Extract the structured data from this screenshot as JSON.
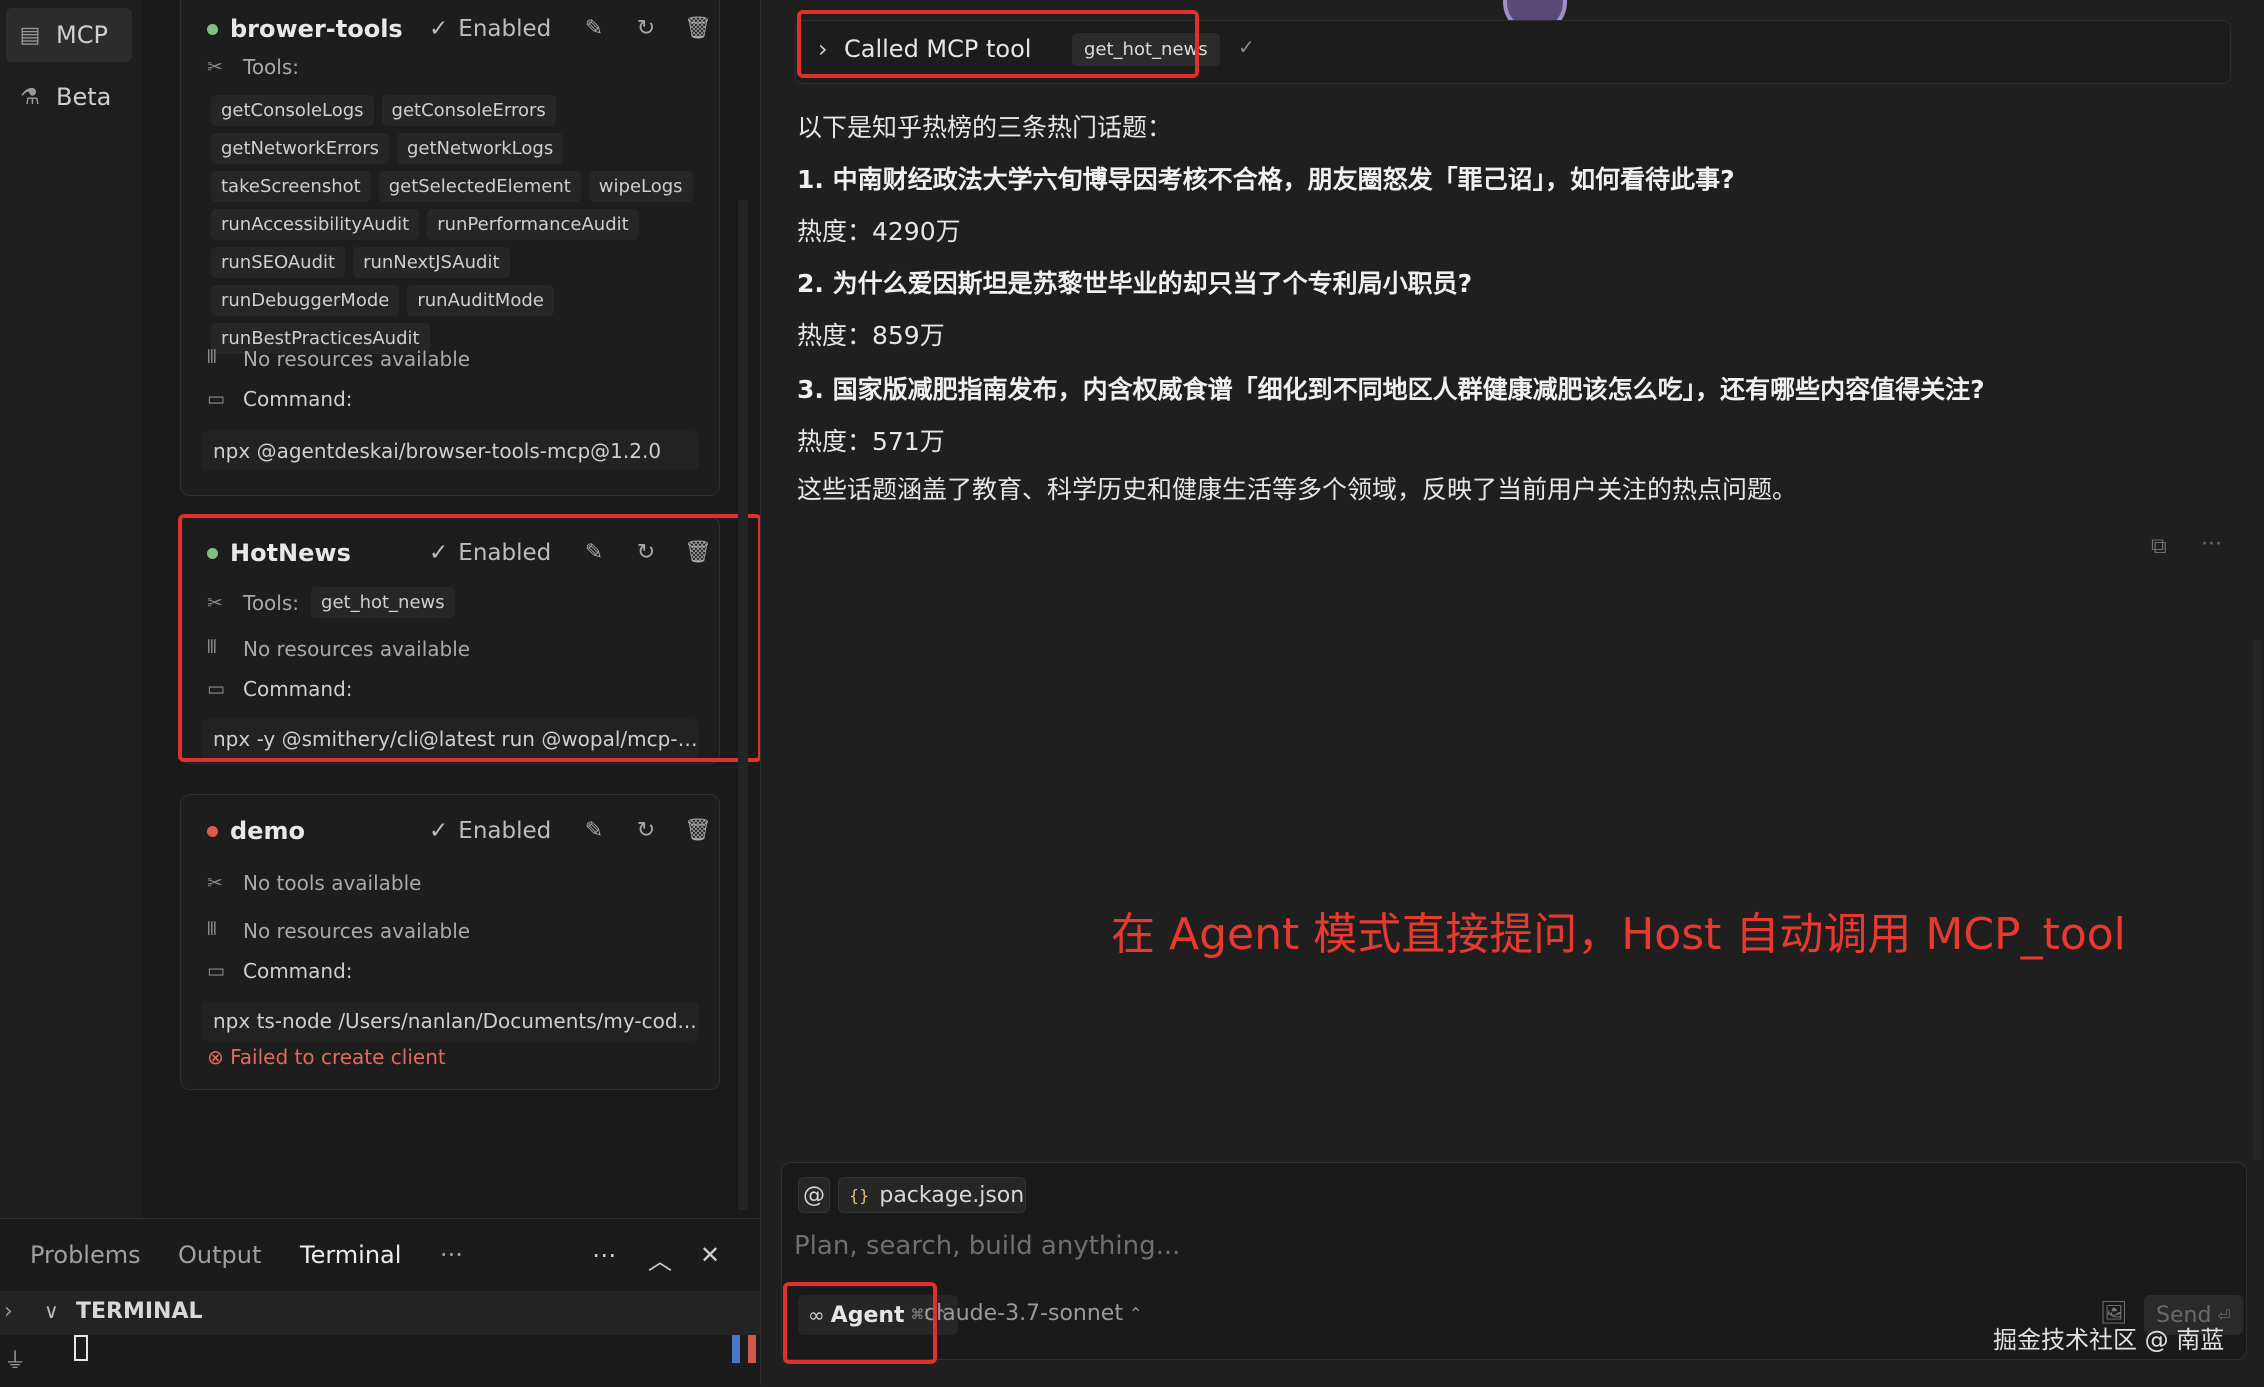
{
  "nav": {
    "items": [
      {
        "label": "MCP",
        "icon": "server-icon",
        "active": true
      },
      {
        "label": "Beta",
        "icon": "flask-icon",
        "active": false
      }
    ]
  },
  "servers": [
    {
      "name": "brower-tools",
      "status": "green",
      "enabled_label": "Enabled",
      "tools_label": "Tools:",
      "tools": [
        "getConsoleLogs",
        "getConsoleErrors",
        "getNetworkErrors",
        "getNetworkLogs",
        "takeScreenshot",
        "getSelectedElement",
        "wipeLogs",
        "runAccessibilityAudit",
        "runPerformanceAudit",
        "runSEOAudit",
        "runNextJSAudit",
        "runDebuggerMode",
        "runAuditMode",
        "runBestPracticesAudit"
      ],
      "resources": "No resources available",
      "command_label": "Command:",
      "command": "npx @agentdeskai/browser-tools-mcp@1.2.0"
    },
    {
      "name": "HotNews",
      "status": "green",
      "enabled_label": "Enabled",
      "tools_label": "Tools:",
      "tools": [
        "get_hot_news"
      ],
      "resources": "No resources available",
      "command_label": "Command:",
      "command": "npx -y @smithery/cli@latest run @wopal/mcp-s..."
    },
    {
      "name": "demo",
      "status": "red",
      "enabled_label": "Enabled",
      "tools_text": "No tools available",
      "resources": "No resources available",
      "command_label": "Command:",
      "command": "npx ts-node /Users/nanlan/Documents/my-cod...",
      "error": "Failed to create client"
    }
  ],
  "bottom_panel": {
    "tabs": [
      "Problems",
      "Output",
      "Terminal"
    ],
    "active_tab": "Terminal",
    "more": "···",
    "terminal_header": "TERMINAL"
  },
  "chat": {
    "tool_call": {
      "label": "Called MCP tool",
      "tool": "get_hot_news"
    },
    "lines": [
      {
        "text": "以下是知乎热榜的三条热门话题：",
        "bold": false
      },
      {
        "text": "1. 中南财经政法大学六旬博导因考核不合格，朋友圈怒发「罪己诏」，如何看待此事?",
        "bold": true
      },
      {
        "text": "热度：4290万",
        "bold": false
      },
      {
        "text": "2. 为什么爱因斯坦是苏黎世毕业的却只当了个专利局小职员?",
        "bold": true
      },
      {
        "text": "热度：859万",
        "bold": false
      },
      {
        "text": "3. 国家版减肥指南发布，内含权威食谱「细化到不同地区人群健康减肥该怎么吃」，还有哪些内容值得关注?",
        "bold": true
      },
      {
        "text": "热度：571万",
        "bold": false
      },
      {
        "text": "这些话题涵盖了教育、科学历史和健康生活等多个领域，反映了当前用户关注的热点问题。",
        "bold": false
      }
    ],
    "annotation": "在 Agent 模式直接提问，Host 自动调用 MCP_tool",
    "input": {
      "at": "@",
      "file_chip": "package.json",
      "placeholder": "Plan, search, build anything...",
      "mode": "Agent",
      "mode_shortcut": "⌘I",
      "model": "claude-3.7-sonnet",
      "send": "Send"
    },
    "watermark": "掘金技术社区 @ 南蓝"
  },
  "colors": {
    "highlight_red": "#e0302a",
    "status_green": "#7fbf7f",
    "status_red": "#e05a4f",
    "error_text": "#e06b5f"
  }
}
